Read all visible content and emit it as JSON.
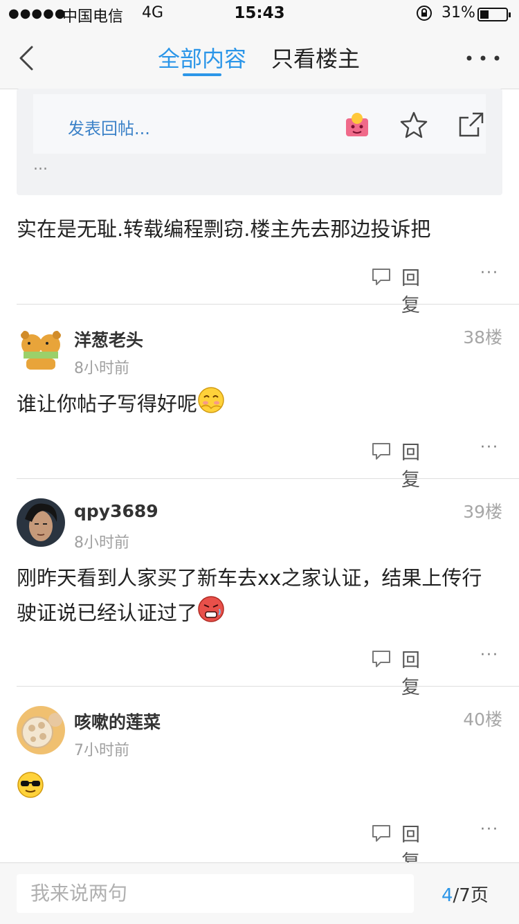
{
  "status_bar": {
    "signal": "●●●●●",
    "carrier": "中国电信",
    "network": "4G",
    "time": "15:43",
    "battery_percent": "31%"
  },
  "nav": {
    "tab_all": "全部内容",
    "tab_op_only": "只看楼主",
    "active_tab": "全部内容",
    "accent_color": "#2c96e8"
  },
  "quote_card": {
    "reply_placeholder": "发表回帖...",
    "ellipsis": "..."
  },
  "posts": [
    {
      "content": "实在是无耻.转载编程剽窃.楼主先去那边投诉把",
      "reply_label": "回复",
      "more": "···"
    },
    {
      "username": "洋葱老头",
      "time_ago": "8小时前",
      "floor": "38楼",
      "content": "谁让你帖子写得好呢",
      "emoji": "shy-smile-emoji",
      "reply_label": "回复",
      "more": "···"
    },
    {
      "username": "qpy3689",
      "time_ago": "8小时前",
      "floor": "39楼",
      "content": "刚昨天看到人家买了新车去xx之家认证，结果上传行驶证说已经认证过了",
      "emoji": "angry-red-emoji",
      "reply_label": "回复",
      "more": "···"
    },
    {
      "username": "咳嗽的莲菜",
      "time_ago": "7小时前",
      "floor": "40楼",
      "content": "",
      "emoji": "sunglasses-emoji",
      "reply_label": "回复",
      "more": "···"
    }
  ],
  "bottom_bar": {
    "input_placeholder": "我来说两句",
    "page_current": "4",
    "page_total": "/7页"
  }
}
